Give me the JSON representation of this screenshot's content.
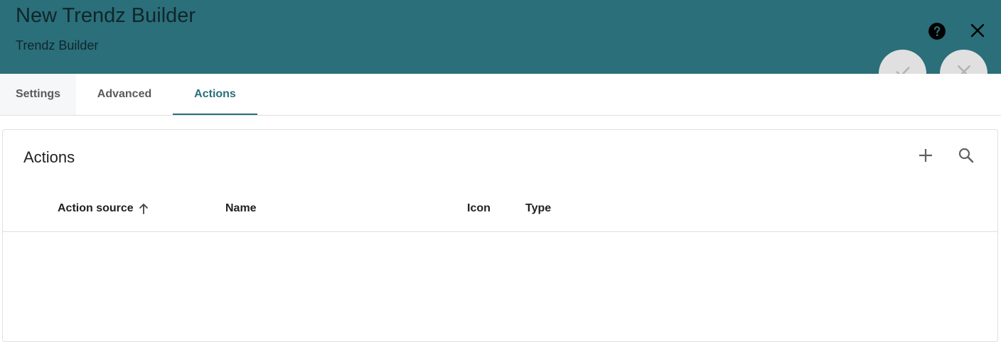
{
  "header": {
    "title": "New Trendz Builder",
    "subtitle": "Trendz Builder",
    "background_color": "#2a6f7a",
    "help_icon": "help-circle-icon",
    "close_icon": "close-icon"
  },
  "fabs": {
    "apply_icon": "check-icon",
    "cancel_icon": "close-icon"
  },
  "tabs": [
    {
      "label": "Settings",
      "active": false
    },
    {
      "label": "Advanced",
      "active": false
    },
    {
      "label": "Actions",
      "active": true
    }
  ],
  "actions_panel": {
    "title": "Actions",
    "add_icon": "plus-icon",
    "search_icon": "search-icon",
    "columns": [
      {
        "label": "Action source",
        "sorted": "ascending"
      },
      {
        "label": "Name"
      },
      {
        "label": "Icon"
      },
      {
        "label": "Type"
      }
    ],
    "rows": []
  }
}
